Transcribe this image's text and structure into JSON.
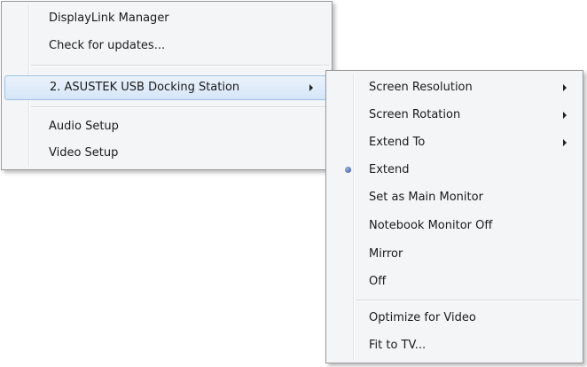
{
  "main_menu": {
    "items": [
      {
        "label": "DisplayLink Manager"
      },
      {
        "label": "Check for updates..."
      },
      {
        "label": "2. ASUSTEK USB Docking Station"
      },
      {
        "label": "Audio Setup"
      },
      {
        "label": "Video Setup"
      }
    ]
  },
  "sub_menu": {
    "items": [
      {
        "label": "Screen Resolution"
      },
      {
        "label": "Screen Rotation"
      },
      {
        "label": "Extend To"
      },
      {
        "label": "Extend"
      },
      {
        "label": "Set as Main Monitor"
      },
      {
        "label": "Notebook Monitor Off"
      },
      {
        "label": "Mirror"
      },
      {
        "label": "Off"
      },
      {
        "label": "Optimize for Video"
      },
      {
        "label": "Fit to TV..."
      }
    ]
  },
  "icons": {
    "submenu_arrow": "chevron-right-icon",
    "selected_radio": "radio-dot-icon"
  },
  "colors": {
    "menu_background": "#f4f5f7",
    "highlight_border": "#9cc0e8",
    "radio_dot": "#2f4e9a"
  }
}
